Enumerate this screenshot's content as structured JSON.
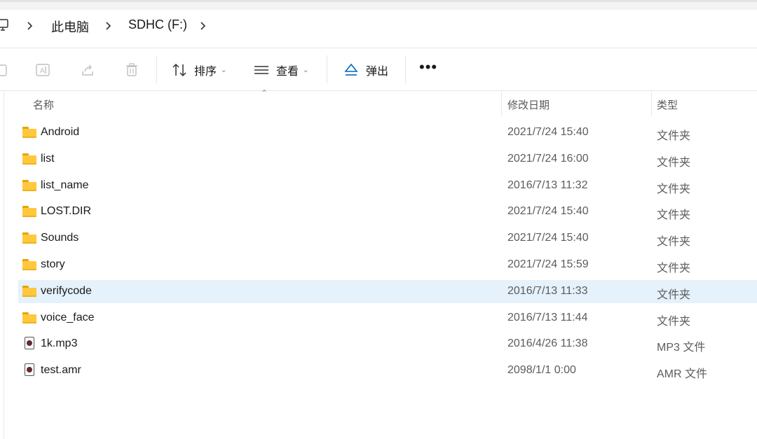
{
  "breadcrumb": {
    "items": [
      "此电脑",
      "SDHC (F:)"
    ]
  },
  "toolbar": {
    "sort_label": "排序",
    "view_label": "查看",
    "eject_label": "弹出",
    "more_label": "•••"
  },
  "columns": {
    "name": "名称",
    "modified": "修改日期",
    "type": "类型"
  },
  "files": [
    {
      "name": "Android",
      "date": "2021/7/24 15:40",
      "type": "文件夹",
      "kind": "folder"
    },
    {
      "name": "list",
      "date": "2021/7/24 16:00",
      "type": "文件夹",
      "kind": "folder"
    },
    {
      "name": "list_name",
      "date": "2016/7/13 11:32",
      "type": "文件夹",
      "kind": "folder"
    },
    {
      "name": "LOST.DIR",
      "date": "2021/7/24 15:40",
      "type": "文件夹",
      "kind": "folder"
    },
    {
      "name": "Sounds",
      "date": "2021/7/24 15:40",
      "type": "文件夹",
      "kind": "folder"
    },
    {
      "name": "story",
      "date": "2021/7/24 15:59",
      "type": "文件夹",
      "kind": "folder"
    },
    {
      "name": "verifycode",
      "date": "2016/7/13 11:33",
      "type": "文件夹",
      "kind": "folder",
      "selected": true
    },
    {
      "name": "voice_face",
      "date": "2016/7/13 11:44",
      "type": "文件夹",
      "kind": "folder"
    },
    {
      "name": "1k.mp3",
      "date": "2016/4/26 11:38",
      "type": "MP3 文件",
      "kind": "media"
    },
    {
      "name": "test.amr",
      "date": "2098/1/1 0:00",
      "type": "AMR 文件",
      "kind": "media"
    }
  ],
  "colors": {
    "selected_row": "#e5f1fb",
    "folder": "#ffc83d",
    "accent": "#0067c0"
  }
}
